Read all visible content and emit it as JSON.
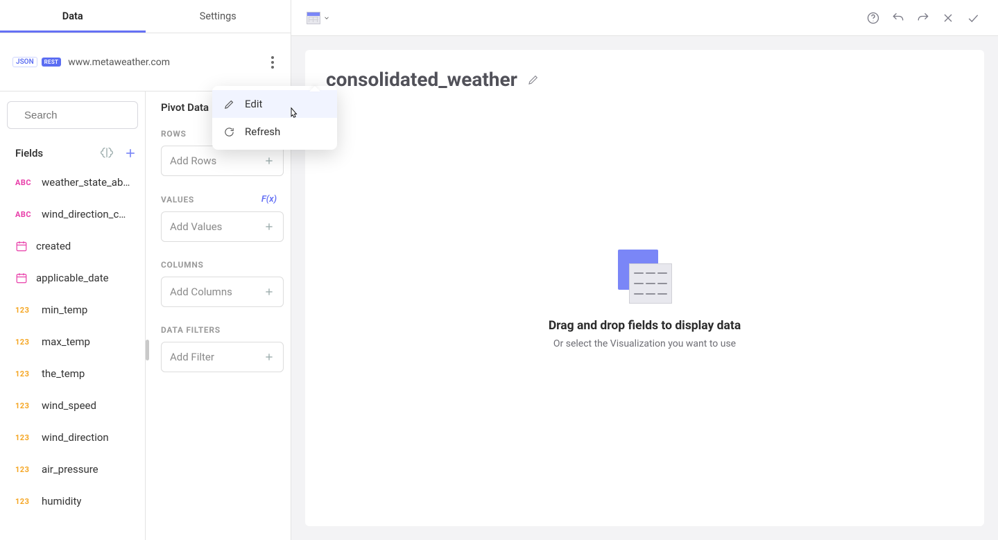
{
  "tabs": {
    "data": "Data",
    "settings": "Settings"
  },
  "datasource": {
    "badge_json": "JSON",
    "badge_rest": "REST",
    "name": "www.metaweather.com"
  },
  "menu": {
    "edit": "Edit",
    "refresh": "Refresh"
  },
  "fields_pane": {
    "search_placeholder": "Search",
    "header": "Fields"
  },
  "fields": [
    {
      "type": "ABC",
      "name": "weather_state_ab…"
    },
    {
      "type": "ABC",
      "name": "wind_direction_c…"
    },
    {
      "type": "CAL",
      "name": "created"
    },
    {
      "type": "CAL",
      "name": "applicable_date"
    },
    {
      "type": "123",
      "name": "min_temp"
    },
    {
      "type": "123",
      "name": "max_temp"
    },
    {
      "type": "123",
      "name": "the_temp"
    },
    {
      "type": "123",
      "name": "wind_speed"
    },
    {
      "type": "123",
      "name": "wind_direction"
    },
    {
      "type": "123",
      "name": "air_pressure"
    },
    {
      "type": "123",
      "name": "humidity"
    }
  ],
  "pivot": {
    "title": "Pivot Data",
    "rows_label": "ROWS",
    "rows_placeholder": "Add Rows",
    "values_label": "VALUES",
    "values_fx": "F(x)",
    "values_placeholder": "Add Values",
    "columns_label": "COLUMNS",
    "columns_placeholder": "Add Columns",
    "filters_label": "DATA FILTERS",
    "filters_placeholder": "Add Filter"
  },
  "canvas": {
    "title": "consolidated_weather",
    "empty_title": "Drag and drop fields to display data",
    "empty_sub": "Or select the Visualization you want to use"
  }
}
